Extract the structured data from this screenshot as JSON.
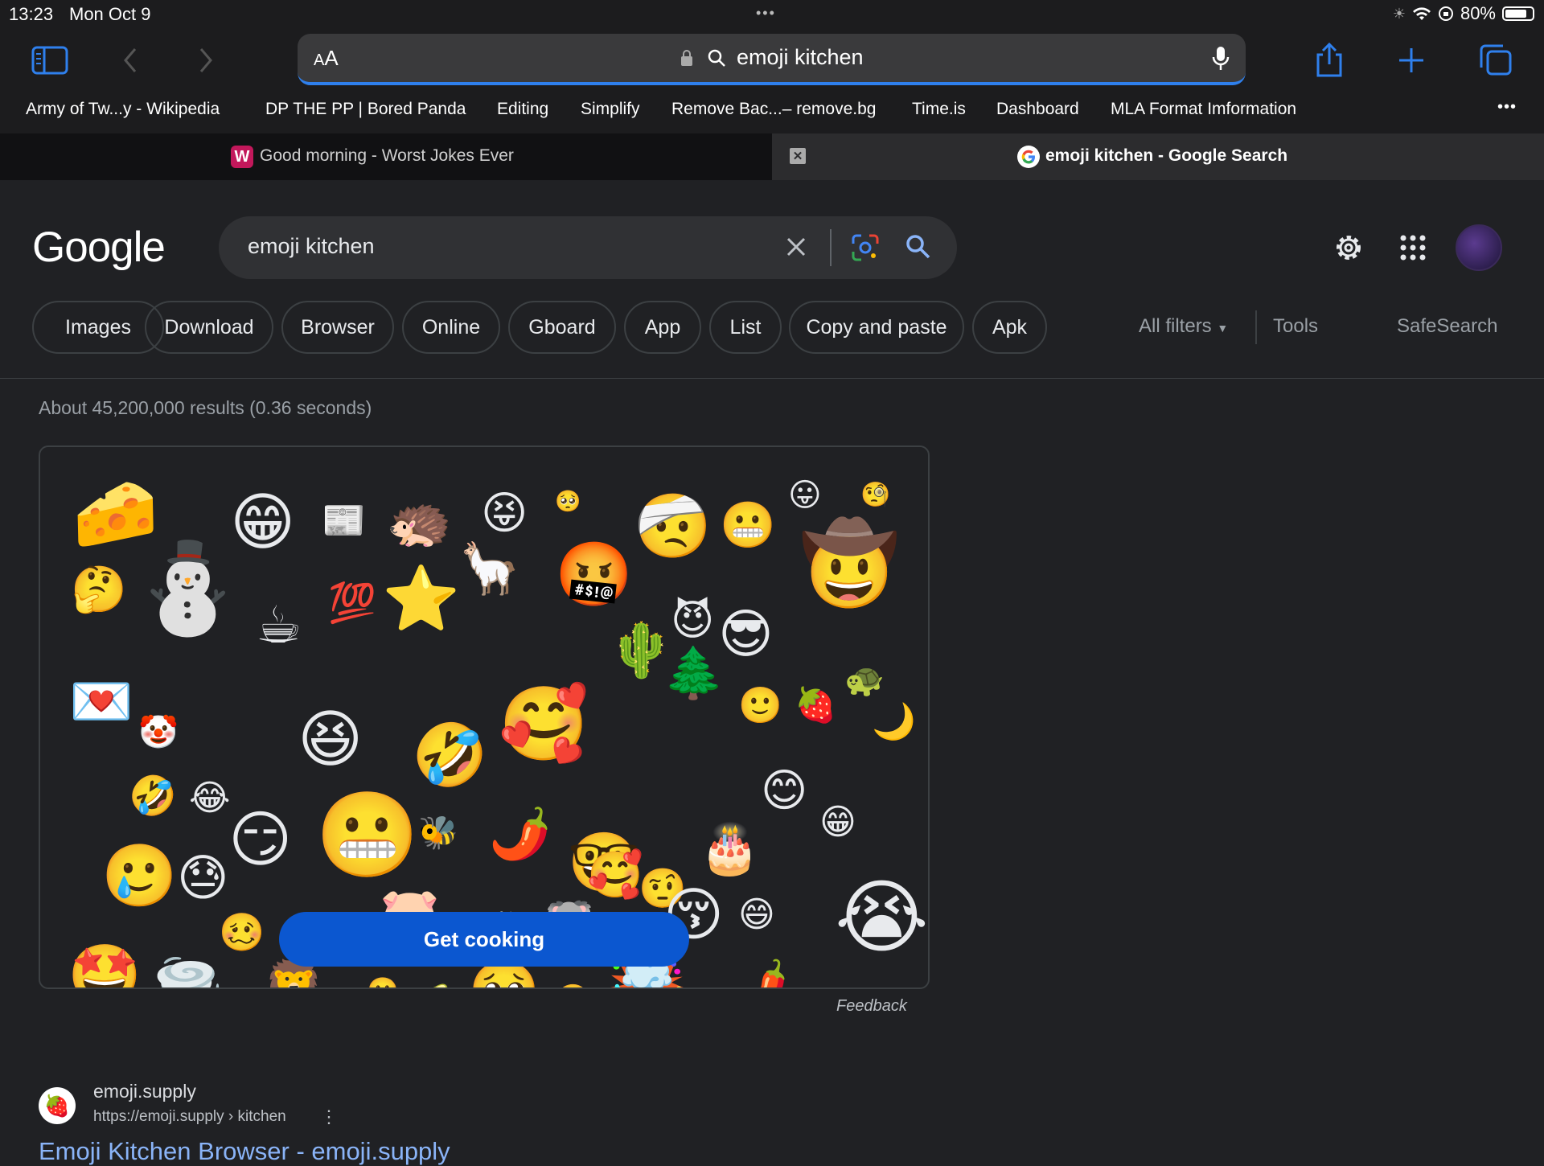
{
  "status_bar": {
    "time": "13:23",
    "date": "Mon Oct 9",
    "battery": "80%",
    "dots": "•••",
    "battery_level": 0.8
  },
  "browser": {
    "address_aa_small": "A",
    "address_aa_big": "A",
    "address_query": "emoji kitchen",
    "bookmarks": [
      "Army of Tw...y - Wikipedia",
      "DP THE PP | Bored Panda",
      "Editing",
      "Simplify",
      "Remove Bac...– remove.bg",
      "Time.is",
      "Dashboard",
      "MLA Format Imformation"
    ],
    "more": "•••",
    "tabs": [
      {
        "title": "Good morning - Worst Jokes Ever",
        "favicon": "W",
        "active": false
      },
      {
        "title": "emoji kitchen - Google Search",
        "favicon": "G",
        "active": true
      }
    ],
    "tab_close": "✕",
    "icons": [
      "sidebar-icon",
      "back-icon",
      "forward-icon",
      "lock-icon",
      "search-icon",
      "microphone-icon",
      "share-icon",
      "new-tab-icon",
      "tabs-icon"
    ]
  },
  "google": {
    "logo": "Google",
    "search_value": "emoji kitchen",
    "chips": [
      "Images",
      "Download",
      "Browser",
      "Online",
      "Gboard",
      "App",
      "List",
      "Copy and paste",
      "Apk"
    ],
    "all_filters": "All filters",
    "tools": "Tools",
    "safesearch": "SafeSearch",
    "stats": "About 45,200,000 results (0.36 seconds)",
    "cta": "Get cooking",
    "feedback": "Feedback",
    "result": {
      "favicon": "🍓",
      "site": "emoji.supply",
      "url": "https://emoji.supply › kitchen",
      "menu": "⋮",
      "title": "Emoji Kitchen Browser - emoji.supply"
    }
  },
  "emoji_collage": [
    "🧀",
    "😁",
    "📰",
    "🦔",
    "😝",
    "🥺",
    "🤕",
    "😬",
    "😛",
    "🧐",
    "🤔",
    "⛄",
    "☕",
    "💯",
    "⭐",
    "🦙",
    "🤬",
    "😈",
    "😎",
    "🤠",
    "💌",
    "🤡",
    "😆",
    "🤣",
    "🥰",
    "🌵",
    "🌲",
    "🙂",
    "🍓",
    "🐢",
    "🌙",
    "🦠",
    "🤣",
    "😂",
    "😏",
    "😬",
    "🐝",
    "🌶️",
    "🤓",
    "🤨",
    "🎂",
    "😊",
    "😁",
    "🥲",
    "😓",
    "🥴",
    "😱",
    "🐷",
    "🐰",
    "🐨",
    "🥰",
    "😚",
    "😄",
    "😭",
    "🤩",
    "🌪️",
    "🦁",
    "🙂",
    "🥑",
    "🥺",
    "😬",
    "🤯",
    "🌶️"
  ]
}
